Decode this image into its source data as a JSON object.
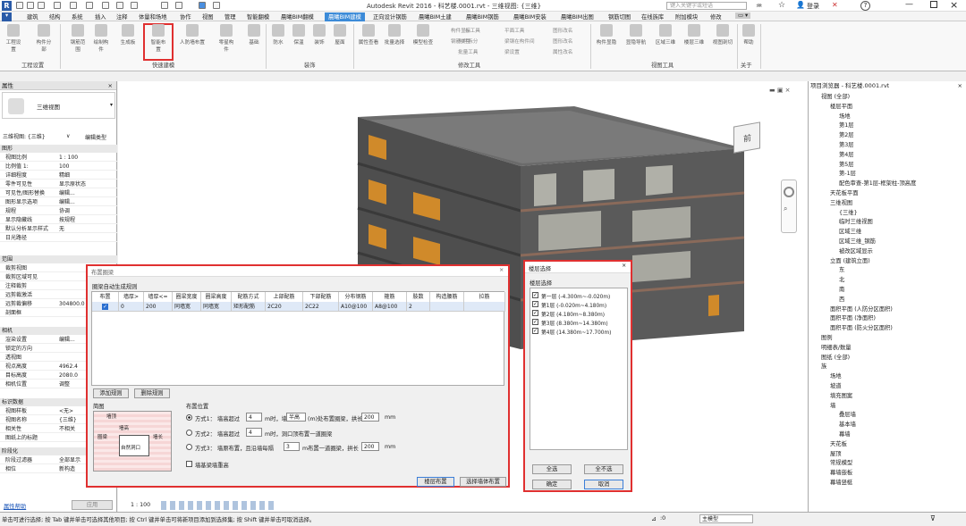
{
  "titlebar": {
    "title": "Autodesk Revit 2016 -   科艺楼.0001.rvt - 三维视图: {三维}",
    "search_placeholder": "键入关键字或短语",
    "user": "登录"
  },
  "tabs": [
    "建筑",
    "结构",
    "系统",
    "插入",
    "注释",
    "体量和场地",
    "协作",
    "视图",
    "管理",
    "智能翻模",
    "晨曦BIM翻模",
    "晨曦BIM建模",
    "正向设计钢筋",
    "晨曦BIM土建",
    "晨曦BIM钢筋",
    "晨曦BIM安装",
    "晨曦BIM出图",
    "钢筋切图",
    "在线族库",
    "附加模块",
    "修改"
  ],
  "ribbon": {
    "buttons": [
      "工程设置",
      "构件分部",
      "钢筋范围",
      "绘制构件",
      "生成板",
      "智能布置",
      "人防墙布置",
      "零星构件",
      "基础",
      "防水",
      "保温",
      "装饰",
      "屋面",
      "属性查看",
      "批量选择",
      "模型检查",
      "构件显示",
      "钢筋类型",
      "板工具",
      "构件拆分",
      "批量工具",
      "平面工具",
      "梁钢在构件间",
      "梁设置",
      "图形改名",
      "图形改名",
      "属性改名",
      "构件显隐",
      "显隐导航",
      "区域三维",
      "楼层三维",
      "视图剖切",
      "帮助"
    ],
    "groups": [
      "工程设置",
      "快速建模",
      "装饰",
      "修改工具",
      "视图工具",
      "关于"
    ]
  },
  "props": {
    "title": "属性",
    "type_name": "三维视图",
    "type_selector": "三维视图: {三维}",
    "edit_type": "编辑类型",
    "sections": {
      "graphics": "图形",
      "range": "范围",
      "camera": "相机",
      "id_data": "标识数据",
      "phasing": "阶段化"
    },
    "rows": [
      {
        "k": "视图比例",
        "v": "1 : 100"
      },
      {
        "k": "比例值 1:",
        "v": "100"
      },
      {
        "k": "详细程度",
        "v": "精细"
      },
      {
        "k": "零件可见性",
        "v": "显示原状态"
      },
      {
        "k": "可见性/图形替换",
        "v": "编辑..."
      },
      {
        "k": "图形显示选项",
        "v": "编辑..."
      },
      {
        "k": "规程",
        "v": "协调"
      },
      {
        "k": "显示隐藏线",
        "v": "按规程"
      },
      {
        "k": "默认分析显示样式",
        "v": "无"
      },
      {
        "k": "日光路径",
        "v": ""
      }
    ],
    "range_rows": [
      {
        "k": "裁剪视图",
        "v": ""
      },
      {
        "k": "裁剪区域可见",
        "v": ""
      },
      {
        "k": "注释裁剪",
        "v": ""
      },
      {
        "k": "远剪裁激活",
        "v": ""
      },
      {
        "k": "远剪裁偏移",
        "v": "304800.0"
      },
      {
        "k": "剖面框",
        "v": ""
      }
    ],
    "camera_rows": [
      {
        "k": "渲染设置",
        "v": "编辑..."
      },
      {
        "k": "锁定的方向",
        "v": ""
      },
      {
        "k": "透视图",
        "v": ""
      },
      {
        "k": "视点高度",
        "v": "4962.4"
      },
      {
        "k": "目标高度",
        "v": "2080.0"
      },
      {
        "k": "相机位置",
        "v": "调整"
      }
    ],
    "id_rows": [
      {
        "k": "视图样板",
        "v": "<无>"
      },
      {
        "k": "视图名称",
        "v": "{三维}"
      },
      {
        "k": "相关性",
        "v": "不相关"
      },
      {
        "k": "图纸上的标题",
        "v": ""
      }
    ],
    "phase_rows": [
      {
        "k": "阶段过滤器",
        "v": "全部显示"
      },
      {
        "k": "相位",
        "v": "新构造"
      }
    ],
    "help": "属性帮助",
    "apply": "应用"
  },
  "dialog": {
    "title": "布置圈梁",
    "subtitle": "圈梁自动生成规则",
    "headers": [
      "布置",
      "墙厚>",
      "墙厚<=",
      "圈梁宽度",
      "圈梁高度",
      "配筋方式",
      "上部配筋",
      "下部配筋",
      "分布钢筋",
      "箍筋",
      "肢数",
      "构造腰筋",
      "拉筋"
    ],
    "row": [
      "",
      "0",
      "200",
      "同墙宽",
      "同墙宽",
      "矩形配筋",
      "2C20",
      "2C22",
      "A10@100",
      "A8@100",
      "2",
      "",
      ""
    ],
    "add_rule": "添加规则",
    "del_rule": "删除规则",
    "diagram": "简图",
    "diagram_labels": [
      "墙顶",
      "墙高",
      "圈梁",
      "墙长",
      "自然洞口"
    ],
    "pos_title": "布置位置",
    "opt1": "方式1：  墙高超过",
    "opt1_v": "4",
    "opt1_b": "m时，墙",
    "opt1_sel": "半高",
    "opt1_c": "(m)处布置圈梁，拱长",
    "opt1_len": "200",
    "mm": "mm",
    "opt2": "方式2：  墙高超过",
    "opt2_v": "4",
    "opt2_b": "m时，洞口顶布置一道圈梁",
    "opt3": "方式3：  墙原布置，且沿墙每隔",
    "opt3_v": "3",
    "opt3_b": "m布置一道圈梁，拱长",
    "opt3_len": "200",
    "rebuild": "墙基梁墙重高",
    "btn_floor": "楼层布置",
    "btn_select": "选择墙体布置"
  },
  "floor": {
    "title": "楼层选择",
    "subtitle": "楼层选择",
    "items": [
      "第一层  (-4.300m~-0.020m)",
      "第1层  (-0.020m~4.180m)",
      "第2层  (4.180m~8.380m)",
      "第3层  (8.380m~14.380m)",
      "第4层  (14.380m~17.700m)"
    ],
    "all": "全选",
    "none": "全不选",
    "ok": "确定",
    "cancel": "取消"
  },
  "browser": {
    "title": "项目浏览器 - 科艺楼.0001.rvt",
    "nodes": [
      "视图 (全部)",
      "楼层平面",
      "场地",
      "第1层",
      "第2层",
      "第3层",
      "第4层",
      "第5层",
      "第-1层",
      "配色审查-第1层-框架柱-顶高度",
      "天花板平面",
      "三维视图",
      "{三维}",
      "临时三维视图",
      "区域三维",
      "区域三维_钢筋",
      "被改区域显示",
      "立面 (建筑立面)",
      "东",
      "北",
      "南",
      "西",
      "面积平面 (人防分区面积)",
      "面积平面 (净面积)",
      "面积平面 (防火分区面积)",
      "图例",
      "明细表/数量",
      "图纸 (全部)",
      "族",
      "场地",
      "坡道",
      "填充图案",
      "墙",
      "叠层墙",
      "基本墙",
      "幕墙",
      "天花板",
      "屋顶",
      "常规模型",
      "幕墙嵌板",
      "幕墙竖梃"
    ]
  },
  "status": {
    "text": "单击可进行选择; 按 Tab 键并单击可选择其他项目; 按 Ctrl 键并单击可将新项目添加到选择集; 按 Shift 键并单击可取消选择。",
    "scale": "1 : 100",
    "model": "主模型",
    "zero": ":0"
  },
  "viewcube": {
    "face": "前"
  }
}
